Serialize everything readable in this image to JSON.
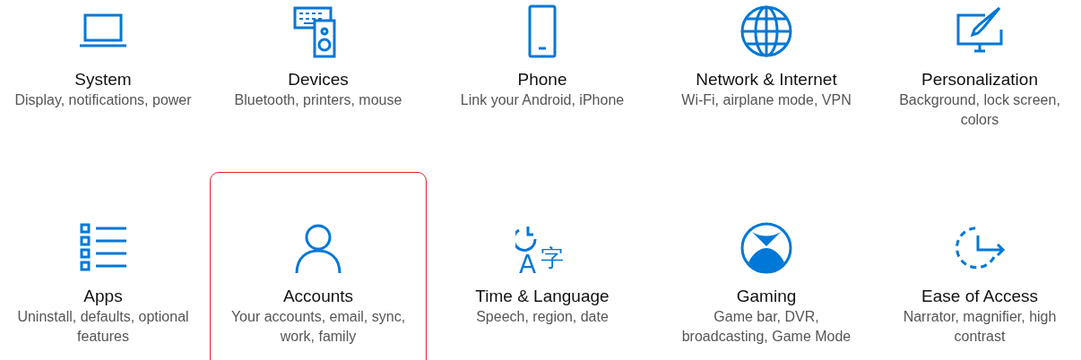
{
  "tiles": [
    {
      "kind": "laptop",
      "title": "System",
      "description": "Display, notifications, power",
      "selected": false
    },
    {
      "kind": "devices",
      "title": "Devices",
      "description": "Bluetooth, printers, mouse",
      "selected": false
    },
    {
      "kind": "phone",
      "title": "Phone",
      "description": "Link your Android, iPhone",
      "selected": false
    },
    {
      "kind": "globe",
      "title": "Network & Internet",
      "description": "Wi-Fi, airplane mode, VPN",
      "selected": false
    },
    {
      "kind": "paint",
      "title": "Personalization",
      "description": "Background, lock screen, colors",
      "selected": false
    },
    {
      "kind": "list",
      "title": "Apps",
      "description": "Uninstall, defaults, optional features",
      "selected": false
    },
    {
      "kind": "person",
      "title": "Accounts",
      "description": "Your accounts, email, sync, work, family",
      "selected": true
    },
    {
      "kind": "language",
      "icon_letters": [
        "A",
        "字"
      ],
      "title": "Time & Language",
      "description": "Speech, region, date",
      "selected": false
    },
    {
      "kind": "xbox",
      "title": "Gaming",
      "description": "Game bar, DVR, broadcasting, Game Mode",
      "selected": false
    },
    {
      "kind": "ease",
      "title": "Ease of Access",
      "description": "Narrator, magnifier, high contrast",
      "selected": false
    }
  ]
}
